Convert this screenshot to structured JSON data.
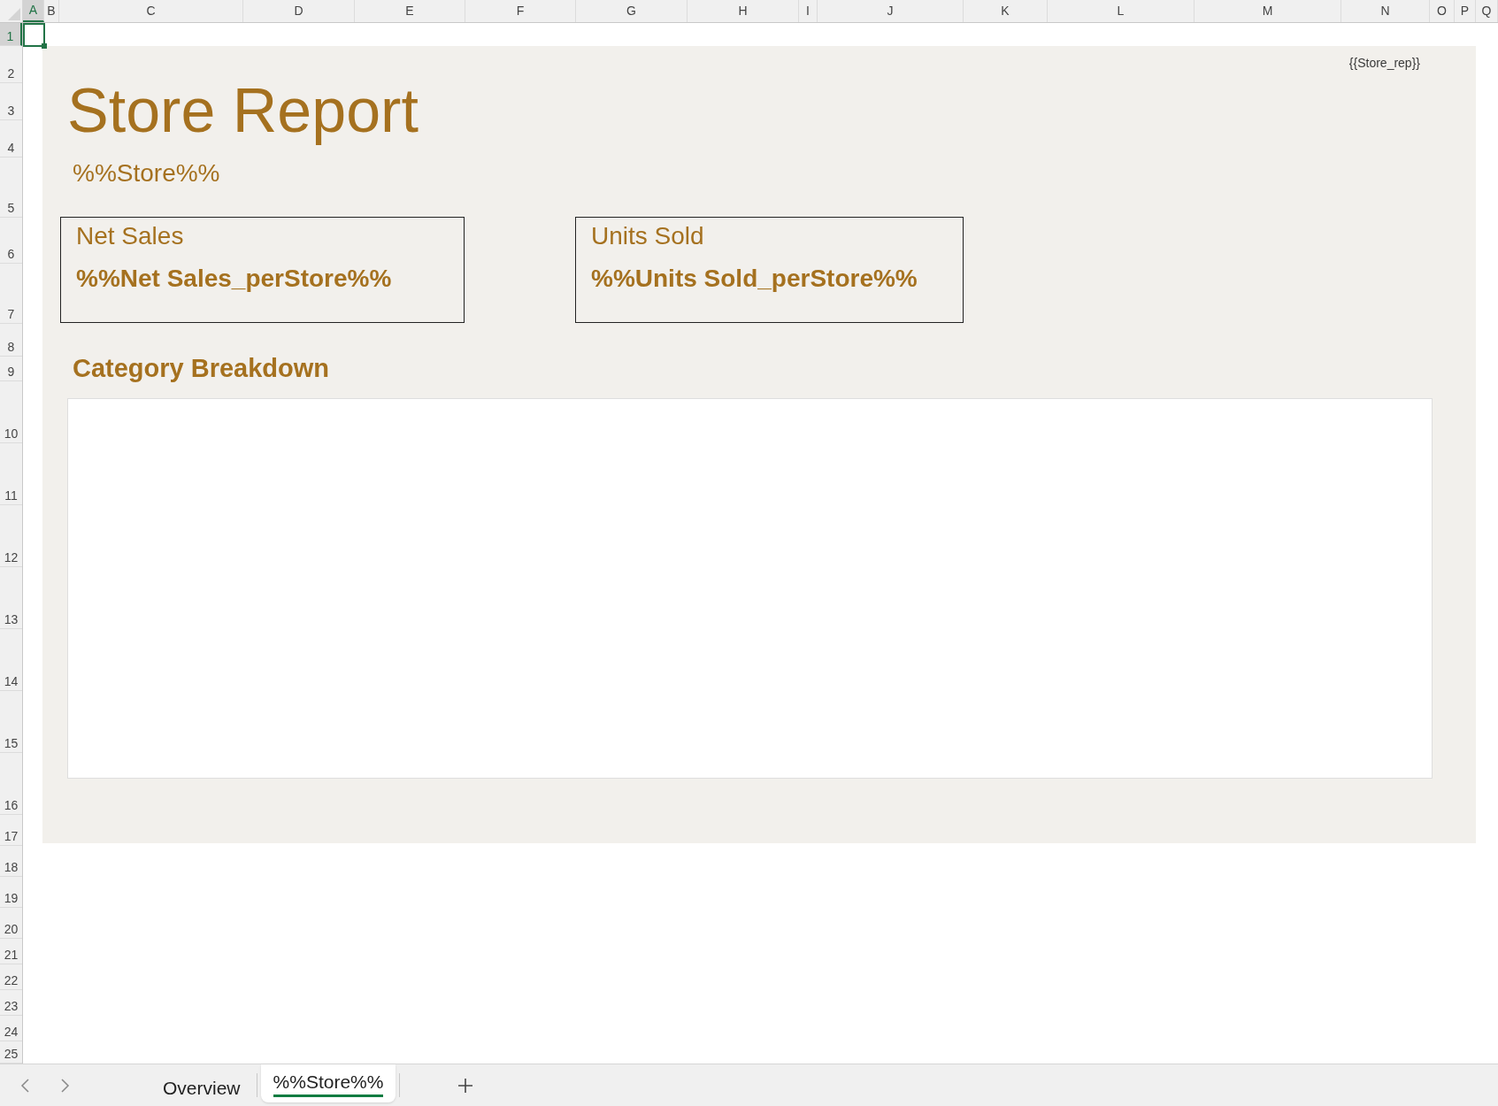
{
  "columns": [
    {
      "label": "A",
      "selected": true
    },
    {
      "label": "B",
      "selected": false
    },
    {
      "label": "C",
      "selected": false
    },
    {
      "label": "D",
      "selected": false
    },
    {
      "label": "E",
      "selected": false
    },
    {
      "label": "F",
      "selected": false
    },
    {
      "label": "G",
      "selected": false
    },
    {
      "label": "H",
      "selected": false
    },
    {
      "label": "I",
      "selected": false
    },
    {
      "label": "J",
      "selected": false
    },
    {
      "label": "K",
      "selected": false
    },
    {
      "label": "L",
      "selected": false
    },
    {
      "label": "M",
      "selected": false
    },
    {
      "label": "N",
      "selected": false
    },
    {
      "label": "O",
      "selected": false
    },
    {
      "label": "P",
      "selected": false
    },
    {
      "label": "Q",
      "selected": false
    }
  ],
  "rows": [
    {
      "label": "1",
      "selected": true
    },
    {
      "label": "2",
      "selected": false
    },
    {
      "label": "3",
      "selected": false
    },
    {
      "label": "4",
      "selected": false
    },
    {
      "label": "5",
      "selected": false
    },
    {
      "label": "6",
      "selected": false
    },
    {
      "label": "7",
      "selected": false
    },
    {
      "label": "8",
      "selected": false
    },
    {
      "label": "9",
      "selected": false
    },
    {
      "label": "10",
      "selected": false
    },
    {
      "label": "11",
      "selected": false
    },
    {
      "label": "12",
      "selected": false
    },
    {
      "label": "13",
      "selected": false
    },
    {
      "label": "14",
      "selected": false
    },
    {
      "label": "15",
      "selected": false
    },
    {
      "label": "16",
      "selected": false
    },
    {
      "label": "17",
      "selected": false
    },
    {
      "label": "18",
      "selected": false
    },
    {
      "label": "19",
      "selected": false
    },
    {
      "label": "20",
      "selected": false
    },
    {
      "label": "21",
      "selected": false
    },
    {
      "label": "22",
      "selected": false
    },
    {
      "label": "23",
      "selected": false
    },
    {
      "label": "24",
      "selected": false
    },
    {
      "label": "25",
      "selected": false
    }
  ],
  "report": {
    "placeholder_tag": "{{Store_rep}}",
    "title": "Store Report",
    "subtitle": "%%Store%%",
    "cards": [
      {
        "label": "Net Sales",
        "value": "%%Net Sales_perStore%%"
      },
      {
        "label": "Units Sold",
        "value": "%%Units Sold_perStore%%"
      }
    ],
    "section_heading": "Category Breakdown"
  },
  "sheet_tabs": [
    {
      "label": "Overview",
      "selected": false
    },
    {
      "label": "%%Store%%",
      "selected": true
    }
  ]
}
